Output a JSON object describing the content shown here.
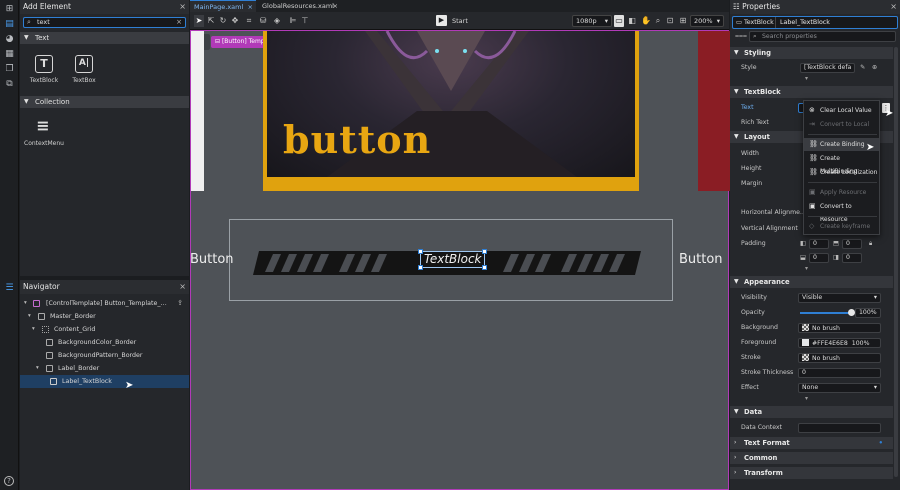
{
  "rail": {
    "icons": [
      "insert-icon",
      "layers-icon",
      "palette-icon",
      "media-icon",
      "pages-icon",
      "resources-icon",
      "navigator-icon",
      "help-icon"
    ]
  },
  "add_element": {
    "title": "Add Element",
    "close_glyph": "×",
    "search_value": "text",
    "search_clear_glyph": "×",
    "sections": {
      "text": "Text",
      "collection": "Collection"
    },
    "tiles": [
      {
        "label": "TextBlock",
        "glyph": "T"
      },
      {
        "label": "TextBox",
        "glyph": "A|"
      },
      {
        "label": "ContextMenu",
        "glyph": "≡"
      }
    ]
  },
  "navigator": {
    "title": "Navigator",
    "close_glyph": "×",
    "tree": [
      {
        "label": "[ControlTemplate] Button_Template_…",
        "level": 0,
        "toggle": "▾"
      },
      {
        "label": "Master_Border",
        "level": 1,
        "toggle": "▾"
      },
      {
        "label": "Content_Grid",
        "level": 2,
        "toggle": "▾"
      },
      {
        "label": "BackgroundColor_Border",
        "level": 3,
        "toggle": ""
      },
      {
        "label": "BackgroundPattern_Border",
        "level": 3,
        "toggle": ""
      },
      {
        "label": "Label_Border",
        "level": 3,
        "toggle": "▾"
      },
      {
        "label": "Label_TextBlock",
        "level": 4,
        "toggle": ""
      }
    ]
  },
  "docs": {
    "tabs": [
      {
        "label": "MainPage.xaml",
        "close": "×"
      },
      {
        "label": "GlobalResources.xaml",
        "close": "×"
      }
    ],
    "start_label": "Start",
    "resolution": "1080p",
    "zoom": "200%",
    "chevron": "▾"
  },
  "canvas": {
    "breadcrumb": "[Button] Template",
    "hero_text": "button",
    "left_label": "Button",
    "right_label": "Button",
    "textblock_label": "TextBlock"
  },
  "properties": {
    "title": "Properties",
    "close_glyph": "×",
    "type_label": "TextBlock",
    "name_value": "Label_TextBlock",
    "search_placeholder": "Search properties",
    "styling": {
      "header": "Styling",
      "style_label": "Style",
      "style_value": "[TextBlock defa"
    },
    "textblock": {
      "header": "TextBlock",
      "text_label": "Text",
      "rich_label": "Rich Text"
    },
    "layout": {
      "header": "Layout",
      "width": "Width",
      "height": "Height",
      "margin": "Margin",
      "halign": "Horizontal Alignme…",
      "valign": "Vertical Alignment",
      "padding": "Padding",
      "padding_values": [
        "0",
        "0",
        "0",
        "0"
      ]
    },
    "appearance": {
      "header": "Appearance",
      "visibility_label": "Visibility",
      "visibility_value": "Visible",
      "opacity_label": "Opacity",
      "opacity_value": "100%",
      "opacity_fraction": 1.0,
      "background_label": "Background",
      "background_value": "No brush",
      "foreground_label": "Foreground",
      "foreground_value": "#FFE4E6E8",
      "foreground_pct": "100%",
      "foreground_color": "#e4e6e8",
      "stroke_label": "Stroke",
      "stroke_value": "No brush",
      "thickness_label": "Stroke Thickness",
      "thickness_value": "0",
      "effect_label": "Effect",
      "effect_value": "None"
    },
    "data": {
      "header": "Data",
      "context_label": "Data Context"
    },
    "collapsed": [
      "Text Format",
      "Common",
      "Transform"
    ],
    "caret": "▾",
    "caret_right": "›"
  },
  "context_menu": {
    "items": [
      {
        "label": "Clear Local Value",
        "disabled": false,
        "icon": "⊗"
      },
      {
        "label": "Convert to Local",
        "disabled": true,
        "icon": "⇥"
      },
      {
        "label": "Create Binding",
        "disabled": false,
        "icon": "⛓"
      },
      {
        "label": "Create MultiBinding",
        "disabled": false,
        "icon": "⛓"
      },
      {
        "label": "Create Localization",
        "disabled": false,
        "icon": "⛓"
      },
      {
        "label": "Apply Resource",
        "disabled": true,
        "icon": "▣"
      },
      {
        "label": "Convert to Resource",
        "disabled": false,
        "icon": "▣"
      },
      {
        "label": "Create keyframe",
        "disabled": true,
        "icon": "◇"
      }
    ]
  },
  "colors": {
    "accent": "#2f7fd4",
    "selection": "#b13ab8",
    "gold": "#e0a20e",
    "nav_selected": "#1f3f63"
  }
}
